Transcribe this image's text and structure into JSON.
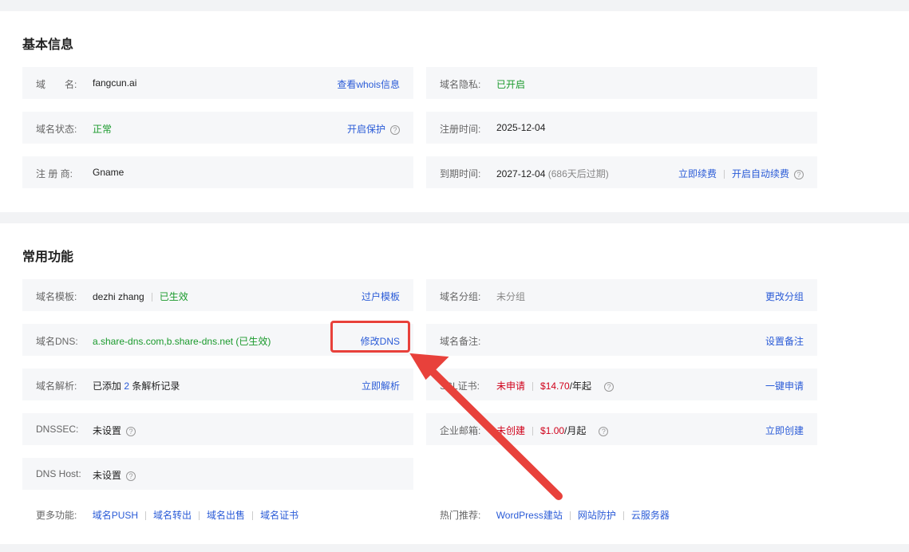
{
  "basic": {
    "title": "基本信息",
    "domain_label": "域　　名:",
    "domain_value": "fangcun.ai",
    "whois_link": "查看whois信息",
    "privacy_label": "域名隐私:",
    "privacy_value": "已开启",
    "status_label": "域名状态:",
    "status_value": "正常",
    "protect_link": "开启保护",
    "reg_time_label": "注册时间:",
    "reg_time_value": "2025-12-04",
    "registrar_label": "注 册 商:",
    "registrar_value": "Gname",
    "expire_label": "到期时间:",
    "expire_value": "2027-12-04",
    "expire_note": "(686天后过期)",
    "renew_link": "立即续费",
    "auto_renew_link": "开启自动续费"
  },
  "common": {
    "title": "常用功能",
    "template_label": "域名模板:",
    "template_value": "dezhi zhang",
    "template_status": "已生效",
    "transfer_template_link": "过户模板",
    "group_label": "域名分组:",
    "group_value": "未分组",
    "change_group_link": "更改分组",
    "dns_label": "域名DNS:",
    "dns_value": "a.share-dns.com,b.share-dns.net (已生效)",
    "modify_dns_link": "修改DNS",
    "note_label": "域名备注:",
    "set_note_link": "设置备注",
    "resolve_label": "域名解析:",
    "resolve_prefix": "已添加",
    "resolve_count": "2",
    "resolve_suffix": "条解析记录",
    "resolve_link": "立即解析",
    "ssl_label": "SSL证书:",
    "ssl_status": "未申请",
    "ssl_price": "$14.70",
    "ssl_unit": "/年起",
    "ssl_link": "一键申请",
    "dnssec_label": "DNSSEC:",
    "dnssec_value": "未设置",
    "mail_label": "企业邮箱:",
    "mail_status": "未创建",
    "mail_price": "$1.00",
    "mail_unit": "/月起",
    "mail_link": "立即创建",
    "dnshost_label": "DNS Host:",
    "dnshost_value": "未设置",
    "more_label": "更多功能:",
    "more_links": [
      "域名PUSH",
      "域名转出",
      "域名出售",
      "域名证书"
    ],
    "hot_label": "热门推荐:",
    "hot_links": [
      "WordPress建站",
      "网站防护",
      "云服务器"
    ]
  },
  "help_icon_glyph": "?",
  "colors": {
    "accent_blue": "#2a5bd7",
    "status_green": "#1a9a2c",
    "status_red": "#d0021b",
    "annotation_red": "#e8413b"
  }
}
